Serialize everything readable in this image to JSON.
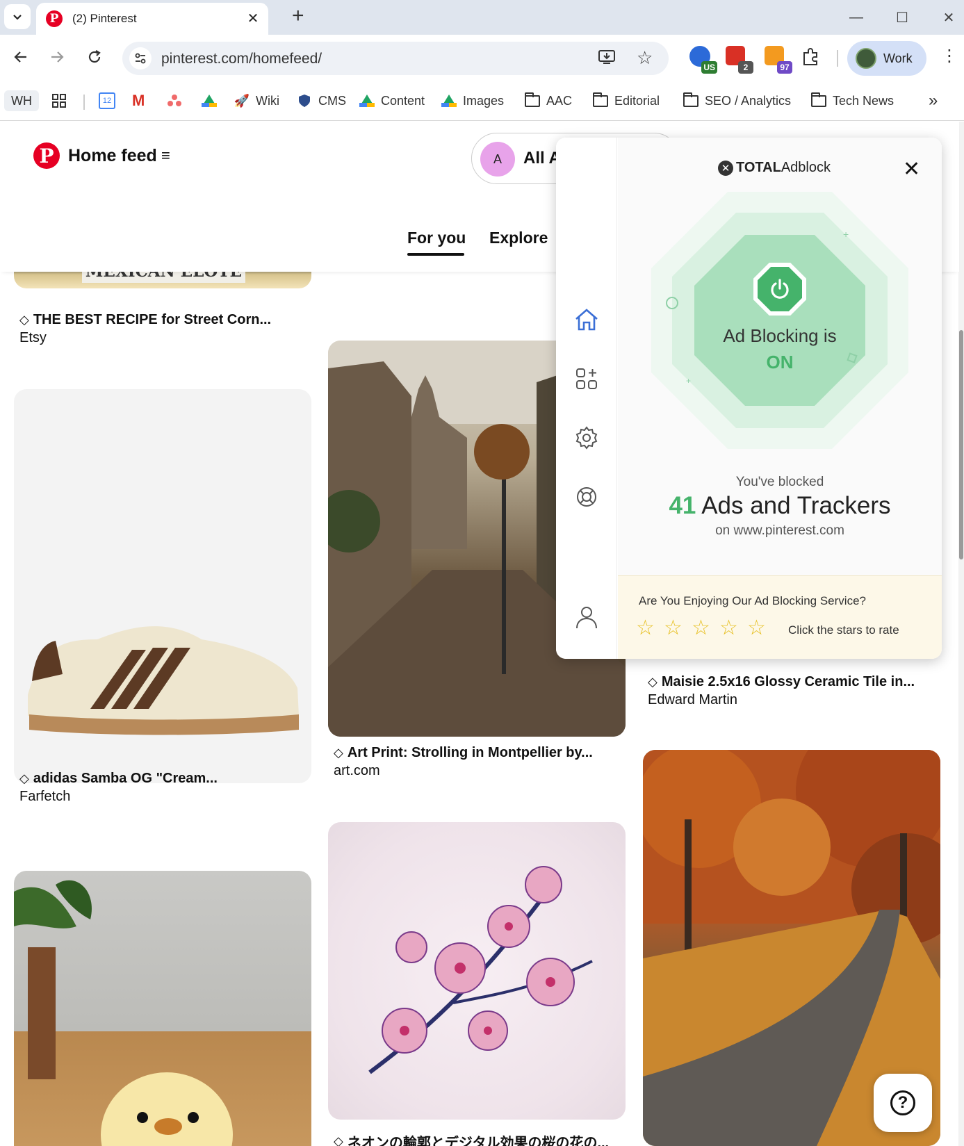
{
  "browser": {
    "tab": {
      "title": "(2) Pinterest",
      "close": "✕"
    },
    "new_tab": "+",
    "window": {
      "minimize": "—",
      "maximize": "☐",
      "close": "✕"
    },
    "url": "pinterest.com/homefeed/",
    "extensions": [
      {
        "name": "vpn-extension-icon",
        "badge": "US",
        "badge_color": "#2e7d32"
      },
      {
        "name": "calendar-extension-icon",
        "badge": "2",
        "badge_color": "#555555"
      },
      {
        "name": "mail-extension-icon",
        "badge": "97",
        "badge_color": "#6f4ac6"
      },
      {
        "name": "puzzle-extensions-icon",
        "badge": ""
      }
    ],
    "profile": {
      "name": "Work"
    },
    "bookmarks": {
      "wh": "WH",
      "calendar_day": "12",
      "wiki": "Wiki",
      "cms": "CMS",
      "content": "Content",
      "images": "Images",
      "aac": "AAC",
      "editorial": "Editorial",
      "seo": "SEO / Analytics",
      "tech": "Tech News",
      "more": "»"
    }
  },
  "pinterest": {
    "header": {
      "title": "Home feed",
      "menu_icon": "≡"
    },
    "board": {
      "avatar_letter": "A",
      "name": "All A"
    },
    "tabs": [
      {
        "label": "For you"
      },
      {
        "label": "Explore"
      }
    ],
    "pins": [
      {
        "title": "THE BEST RECIPE for Street Corn...",
        "source": "Etsy",
        "image_text": "MEXICAN ELOTE"
      },
      {
        "title": "Art Print: Strolling in Montpellier by...",
        "source": "art.com"
      },
      {
        "title": "Maisie 2.5x16 Glossy Ceramic Tile in...",
        "source": "Edward Martin"
      },
      {
        "title": "adidas Samba OG \"Cream...",
        "source": "Farfetch"
      },
      {
        "title": "ネオンの輪郭とデジタル効果の桜の花の...",
        "source": ""
      }
    ],
    "help": "?"
  },
  "adblock": {
    "brand_bold": "TOTAL",
    "brand_light": "Adblock",
    "close": "✕",
    "status_label": "Ad Blocking is",
    "status_value": "ON",
    "blocked_intro": "You've blocked",
    "blocked_count": "41",
    "blocked_label": "Ads and Trackers",
    "domain_line": "on www.pinterest.com",
    "rating_question": "Are You Enjoying Our Ad Blocking Service?",
    "rating_hint": "Click the stars to rate",
    "accent": "#45b36b"
  }
}
